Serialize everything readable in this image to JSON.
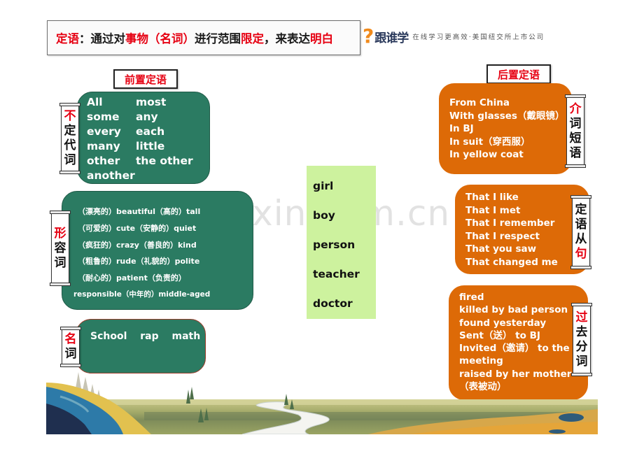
{
  "title": {
    "segments": [
      {
        "text": "定语",
        "color": "red"
      },
      {
        "text": "：通过对",
        "color": "black"
      },
      {
        "text": "事物（名词）",
        "color": "red"
      },
      {
        "text": "进行范围",
        "color": "black"
      },
      {
        "text": "限定",
        "color": "red"
      },
      {
        "text": "，来表达",
        "color": "black"
      },
      {
        "text": "明白",
        "color": "red"
      }
    ]
  },
  "brand": {
    "mark": "?",
    "name": "跟谁学",
    "slogan": "在线学习更高效·美国纽交所上市公司"
  },
  "watermark": "www.zixin.com.cn",
  "pre_modifier": {
    "label": "前置定语",
    "pronouns": {
      "scroll": [
        {
          "text": "不",
          "red": true
        },
        {
          "text": "定",
          "red": false
        },
        {
          "text": "代",
          "red": false
        },
        {
          "text": "词",
          "red": false
        }
      ],
      "words": [
        "All",
        "most",
        "some",
        "any",
        "every",
        "each",
        "many",
        "little",
        "other",
        "the other",
        "another"
      ]
    },
    "adjectives": {
      "scroll": [
        {
          "text": "形",
          "red": true
        },
        {
          "text": "容",
          "red": false
        },
        {
          "text": "词",
          "red": false
        }
      ],
      "lines": [
        "（漂亮的）beautiful（高的）tall",
        "（可爱的）cute（安静的）quiet",
        "（疯狂的）crazy（善良的）kind",
        "（粗鲁的）rude（礼貌的）polite",
        "（耐心的）patient（负责的）",
        "responsible（中年的）middle-aged"
      ]
    },
    "nouns": {
      "scroll": [
        {
          "text": "名",
          "red": true
        },
        {
          "text": "词",
          "red": false
        }
      ],
      "line": "School rap math"
    }
  },
  "head_nouns": [
    "girl",
    "boy",
    "person",
    "teacher",
    "doctor"
  ],
  "post_modifier": {
    "label": "后置定语",
    "prepositional": {
      "scroll": [
        {
          "text": "介",
          "red": true
        },
        {
          "text": "词",
          "red": false
        },
        {
          "text": "短",
          "red": false
        },
        {
          "text": "语",
          "red": false
        }
      ],
      "lines": [
        "From China",
        "With glasses（戴眼镜）",
        "In BJ",
        "In suit（穿西服）",
        "In yellow coat"
      ]
    },
    "clause": {
      "scroll": [
        {
          "text": "定",
          "red": false
        },
        {
          "text": "语",
          "red": false
        },
        {
          "text": "从",
          "red": false
        },
        {
          "text": "句",
          "red": true
        }
      ],
      "lines": [
        "That I like",
        "That I met",
        "That I remember",
        "That I respect",
        "That you saw",
        "That changed me"
      ]
    },
    "past_participle": {
      "scroll": [
        {
          "text": "过",
          "red": true
        },
        {
          "text": "去",
          "red": false
        },
        {
          "text": "分",
          "red": false
        },
        {
          "text": "词",
          "red": false
        }
      ],
      "lines": [
        "fired",
        "killed by bad person",
        "found yesterday",
        "Sent（送） to BJ",
        "Invited（邀请） to the",
        "meeting",
        "raised by her mother",
        "（表被动）"
      ]
    }
  },
  "colors": {
    "red": "#e60012",
    "green_box": "#2b7b62",
    "orange_box": "#dd6a07",
    "noun_column": "#cdf29e",
    "brand_orange": "#f08a1c"
  }
}
